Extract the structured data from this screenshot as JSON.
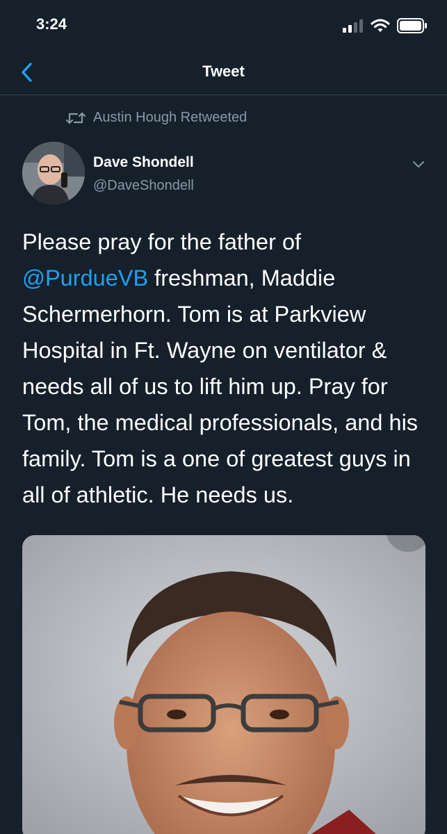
{
  "status_bar": {
    "time": "3:24",
    "signal_icon": "cellular-signal-icon",
    "wifi_icon": "wifi-icon",
    "battery_icon": "battery-icon"
  },
  "nav": {
    "title": "Tweet",
    "back_icon": "chevron-left-icon"
  },
  "tweet": {
    "retweet_context": "Austin Hough Retweeted",
    "retweet_icon": "retweet-icon",
    "author": {
      "name": "Dave Shondell",
      "handle": "@DaveShondell"
    },
    "caret_icon": "chevron-down-icon",
    "text_before_mention": "Please pray for the father of ",
    "mention": "@PurdueVB",
    "text_after_mention": " freshman, Maddie Schermerhorn. Tom is at Parkview Hospital in Ft. Wayne on ventilator & needs all of us to lift him up. Pray for Tom, the medical professionals, and his family. Tom is a one of greatest guys in all of athletic. He needs us."
  },
  "colors": {
    "background": "#15202b",
    "divider": "#38444d",
    "accent": "#1da1f2",
    "secondary_text": "#8899a6"
  }
}
